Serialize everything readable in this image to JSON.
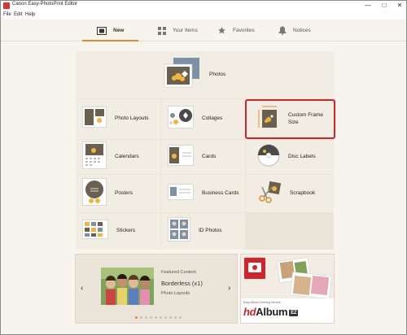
{
  "window": {
    "title": "Canon Easy-PhotoPrint Editor",
    "controls": [
      "—",
      "□",
      "✕"
    ]
  },
  "menu": [
    "File",
    "Edit",
    "Help"
  ],
  "tabs": [
    {
      "label": "New",
      "icon": "new-document-icon",
      "active": true
    },
    {
      "label": "Your Items",
      "icon": "grid-icon",
      "active": false
    },
    {
      "label": "Favorites",
      "icon": "star-icon",
      "active": false
    },
    {
      "label": "Notices",
      "icon": "bell-icon",
      "active": false
    }
  ],
  "tiles": {
    "photos": "Photos",
    "photo_layouts": "Photo Layouts",
    "collages": "Collages",
    "custom_frame_size_line1": "Custom Frame",
    "custom_frame_size_line2": "Size",
    "calendars": "Calendars",
    "cards": "Cards",
    "disc_labels": "Disc Labels",
    "posters": "Posters",
    "business_cards": "Business Cards",
    "scrapbook": "Scrapbook",
    "stickers": "Stickers",
    "id_photos": "ID Photos"
  },
  "featured": {
    "caption": "Featured Content",
    "title": "Borderless (x1)",
    "subtitle": "Photo Layouts",
    "prev": "‹",
    "next": "›",
    "page_count": 10,
    "active_page": 0
  },
  "promo": {
    "service": "Easy Album Ordering Service",
    "brand_prefix": "hd",
    "brand_main": "Album",
    "brand_badge": "EZ"
  },
  "colors": {
    "accent": "#e08a2c",
    "highlight": "#d4222a",
    "tile_bg": "#f2ede3",
    "panel_bg": "#ebe5d9"
  }
}
